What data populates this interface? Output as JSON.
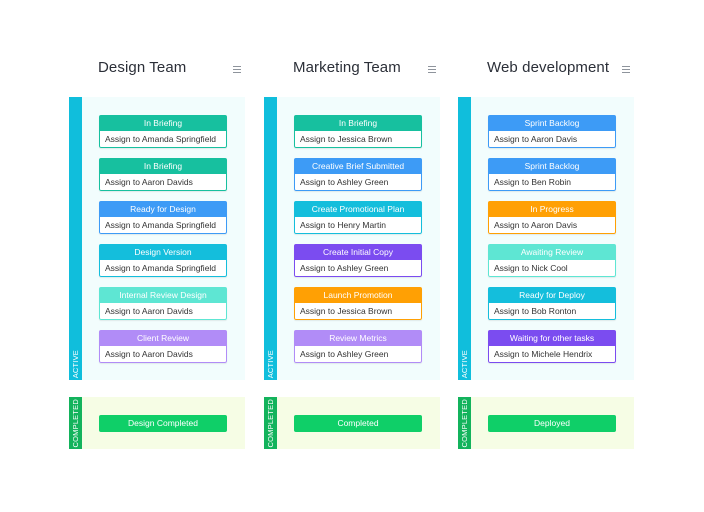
{
  "lane_labels": {
    "active": "ACTIVE",
    "completed": "COMPLETED"
  },
  "icons": {
    "column_menu": "hamburger-menu-icon"
  },
  "columns": [
    {
      "title": "Design Team",
      "cards": [
        {
          "status": "In Briefing",
          "assignee": "Assign to Amanda Springfield",
          "color": "#17c09f"
        },
        {
          "status": "In Briefing",
          "assignee": "Assign to Aaron Davids",
          "color": "#17c09f"
        },
        {
          "status": "Ready for Design",
          "assignee": "Assign to Amanda Springfield",
          "color": "#3d9bf6"
        },
        {
          "status": "Design Version",
          "assignee": "Assign to Amanda Springfield",
          "color": "#14bedc"
        },
        {
          "status": "Internal Review Design",
          "assignee": "Assign to Aaron Davids",
          "color": "#5ee6d3"
        },
        {
          "status": "Client Review",
          "assignee": "Assign to Aaron Davids",
          "color": "#b18cf7"
        }
      ],
      "completed": {
        "label": "Design Completed",
        "color": "#0fcf68"
      }
    },
    {
      "title": "Marketing Team",
      "cards": [
        {
          "status": "In Briefing",
          "assignee": "Assign to Jessica Brown",
          "color": "#17c09f"
        },
        {
          "status": "Creative Brief Submitted",
          "assignee": "Assign to Ashley Green",
          "color": "#3d9bf6"
        },
        {
          "status": "Create Promotional Plan",
          "assignee": "Assign to Henry Martin",
          "color": "#14bedc"
        },
        {
          "status": "Create Initial Copy",
          "assignee": "Assign to Ashley Green",
          "color": "#7b4cf0"
        },
        {
          "status": "Launch Promotion",
          "assignee": "Assign to Jessica Brown",
          "color": "#ffa004"
        },
        {
          "status": "Review Metrics",
          "assignee": "Assign to Ashley Green",
          "color": "#b18cf7"
        }
      ],
      "completed": {
        "label": "Completed",
        "color": "#0fcf68"
      }
    },
    {
      "title": "Web development",
      "cards": [
        {
          "status": "Sprint Backlog",
          "assignee": "Assign to Aaron Davis",
          "color": "#3d9bf6"
        },
        {
          "status": "Sprint Backlog",
          "assignee": "Assign to Ben Robin",
          "color": "#3d9bf6"
        },
        {
          "status": "In Progress",
          "assignee": "Assign to Aaron Davis",
          "color": "#ffa004"
        },
        {
          "status": "Awaiting Review",
          "assignee": "Assign to Nick Cool",
          "color": "#5ee6d3"
        },
        {
          "status": "Ready for Deploy",
          "assignee": "Assign to Bob Ronton",
          "color": "#14bedc"
        },
        {
          "status": "Waiting for other tasks",
          "assignee": "Assign to Michele Hendrix",
          "color": "#7b4cf0"
        }
      ],
      "completed": {
        "label": "Deployed",
        "color": "#0fcf68"
      }
    }
  ]
}
